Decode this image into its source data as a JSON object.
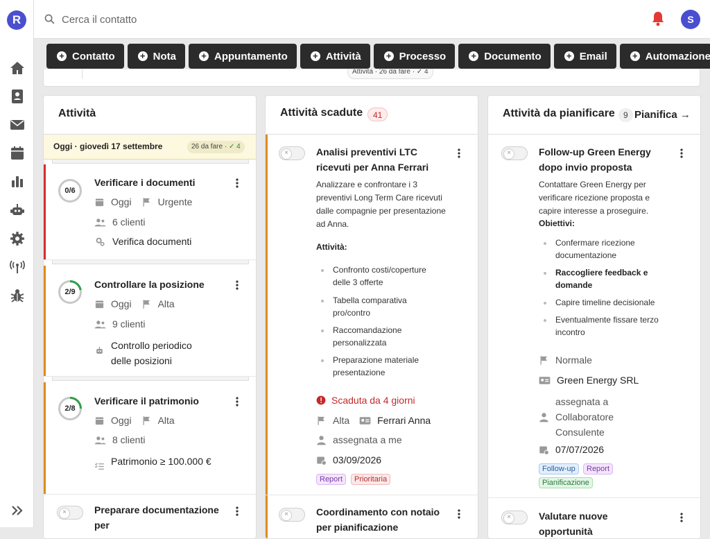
{
  "app": {
    "logo_letter": "R"
  },
  "search": {
    "placeholder": "Cerca il contatto"
  },
  "user": {
    "initial": "S"
  },
  "actions": [
    "Contatto",
    "Nota",
    "Appuntamento",
    "Attività",
    "Processo",
    "Documento",
    "Email",
    "Automazione"
  ],
  "strip": {
    "label": "Attività · 26 da fare · ✓ 4"
  },
  "col1": {
    "title": "Attività",
    "today_label": "Oggi · giovedì 17 settembre",
    "today_badge_todo": "26 da fare ·",
    "today_badge_done": "✓ 4",
    "tasks": [
      {
        "progress": "0/6",
        "progress_value": 0,
        "title": "Verificare i documenti",
        "date": "Oggi",
        "priority": "Urgente",
        "clients": "6 clienti",
        "extra": "Verifica documenti",
        "color": "#d32f2f"
      },
      {
        "progress": "2/9",
        "progress_value": 0.22,
        "title": "Controllare la posizione",
        "date": "Oggi",
        "priority": "Alta",
        "clients": "9 clienti",
        "extra": "Controllo periodico delle posizioni",
        "color": "#e08a1e"
      },
      {
        "progress": "2/8",
        "progress_value": 0.25,
        "title": "Verificare il patrimonio",
        "date": "Oggi",
        "priority": "Alta",
        "clients": "8 clienti",
        "extra": "Patrimonio ≥ 100.000 €",
        "color": "#e08a1e"
      },
      {
        "title": "Preparare documentazione per"
      }
    ]
  },
  "col2": {
    "title": "Attività scadute",
    "count": "41",
    "task1": {
      "title": "Analisi preventivi LTC ricevuti per Anna Ferrari",
      "desc": "Analizzare e confrontare i 3 preventivi Long Term Care ricevuti dalle compagnie per presentazione ad Anna.",
      "subhead": "Attività:",
      "bullets": [
        "Confronto costi/coperture delle 3 offerte",
        "Tabella comparativa pro/contro",
        "Raccomandazione personalizzata",
        "Preparazione materiale presentazione"
      ],
      "overdue": "Scaduta da 4 giorni",
      "priority": "Alta",
      "contact": "Ferrari Anna",
      "assigned": "assegnata a me",
      "date": "03/09/2026",
      "tags": [
        "Report",
        "Prioritaria"
      ]
    },
    "task2": {
      "title": "Coordinamento con notaio per pianificazione"
    }
  },
  "col3": {
    "title": "Attività da pianificare",
    "count": "9",
    "action": "Pianifica →",
    "task1": {
      "title": "Follow-up Green Energy dopo invio proposta",
      "desc": "Contattare Green Energy per verificare ricezione proposta e capire interesse a proseguire.",
      "subhead": "Obiettivi:",
      "bullets": [
        "Confermare ricezione documentazione",
        "Raccogliere feedback e domande",
        "Capire timeline decisionale",
        "Eventualmente fissare terzo incontro"
      ],
      "priority": "Normale",
      "company": "Green Energy SRL",
      "assigned": "assegnata a Collaboratore Consulente",
      "date": "07/07/2026",
      "tags": [
        "Follow-up",
        "Report",
        "Pianificazione"
      ]
    },
    "task2": {
      "title": "Valutare nuove opportunità"
    }
  },
  "colors": {
    "accent": "#4a4fd0",
    "urgent": "#d32f2f",
    "high": "#e08a1e",
    "bell": "#e53935",
    "progress": "#2e9e4a"
  }
}
